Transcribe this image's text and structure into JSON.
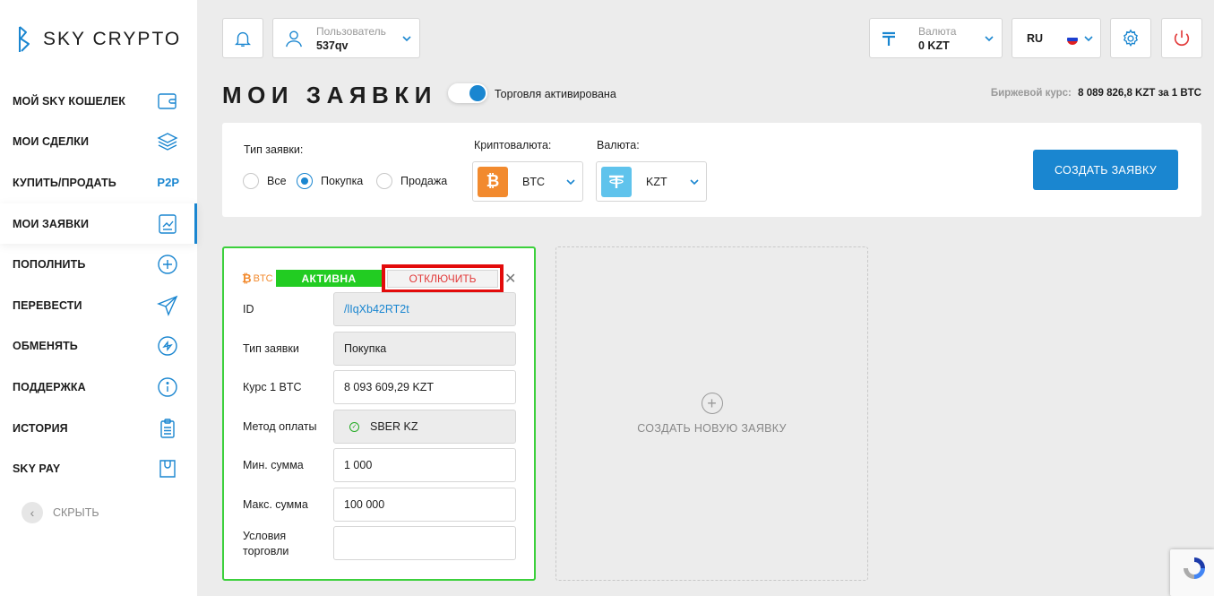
{
  "brand": {
    "name": "SKY CRYPTO"
  },
  "sidebar": {
    "items": [
      {
        "label": "МОЙ SKY КОШЕЛЕК",
        "icon": "wallet-icon"
      },
      {
        "label": "МОИ СДЕЛКИ",
        "icon": "layers-icon"
      },
      {
        "label": "КУПИТЬ/ПРОДАТЬ",
        "badge": "P2P"
      },
      {
        "label": "МОИ ЗАЯВКИ",
        "icon": "chart-icon",
        "active": true
      },
      {
        "label": "ПОПОЛНИТЬ",
        "icon": "plus-circle-icon"
      },
      {
        "label": "ПЕРЕВЕСТИ",
        "icon": "send-icon"
      },
      {
        "label": "ОБМЕНЯТЬ",
        "icon": "exchange-icon"
      },
      {
        "label": "ПОДДЕРЖКА",
        "icon": "info-icon"
      },
      {
        "label": "ИСТОРИЯ",
        "icon": "clipboard-icon"
      },
      {
        "label": "SKY PAY",
        "icon": "bag-icon"
      }
    ],
    "hide_label": "СКРЫТЬ"
  },
  "header": {
    "user_label": "Пользователь",
    "user_value": "537qv",
    "currency_label": "Валюта",
    "currency_value": "0 KZT",
    "language": "RU"
  },
  "page": {
    "title": "МОИ ЗАЯВКИ",
    "trading_label": "Торговля активирована",
    "rate_label": "Биржевой курс:",
    "rate_value": "8 089 826,8 KZT за 1 BTC"
  },
  "filter": {
    "type_label": "Тип заявки:",
    "options": [
      "Все",
      "Покупка",
      "Продажа"
    ],
    "selected": "Покупка",
    "crypto_label": "Криптовалюта:",
    "crypto_value": "BTC",
    "currency_label": "Валюта:",
    "currency_value": "KZT",
    "create_button": "СОЗДАТЬ ЗАЯВКУ"
  },
  "order": {
    "coin": "BTC",
    "status": "АКТИВНА",
    "disable_button": "ОТКЛЮЧИТЬ",
    "rows": [
      {
        "label": "ID",
        "value": "/lIqXb42RT2t"
      },
      {
        "label": "Тип заявки",
        "value": "Покупка"
      },
      {
        "label": "Курс 1 BTC",
        "value": "8 093 609,29 KZT"
      },
      {
        "label": "Метод оплаты",
        "value": "SBER KZ"
      },
      {
        "label": "Мин. сумма",
        "value": "1 000"
      },
      {
        "label": "Макс. сумма",
        "value": "100 000"
      },
      {
        "label": "Условия\nторговли",
        "value": ""
      }
    ]
  },
  "new_order": {
    "label": "СОЗДАТЬ НОВУЮ ЗАЯВКУ"
  },
  "colors": {
    "accent": "#1a86d0",
    "active_border": "#3cd03c",
    "status_green": "#22cc22",
    "danger": "#e23b3b",
    "btc_orange": "#f28a2e",
    "tether_blue": "#5fc3ec"
  }
}
